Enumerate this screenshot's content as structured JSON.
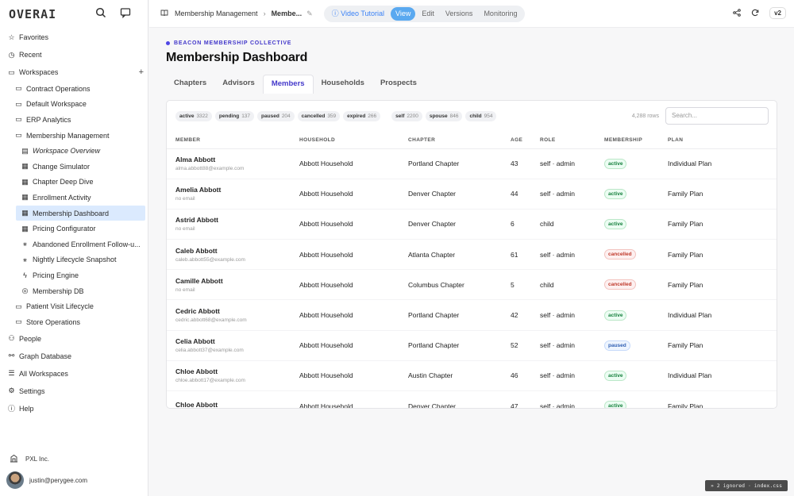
{
  "app": {
    "logo": "OVERAI"
  },
  "sidebar": {
    "top_items": [
      {
        "icon": "star-icon",
        "label": "Favorites"
      },
      {
        "icon": "clock-icon",
        "label": "Recent"
      },
      {
        "icon": "folder-icon",
        "label": "Workspaces"
      }
    ],
    "workspaces": [
      {
        "label": "Contract Operations",
        "level": 1
      },
      {
        "label": "Default Workspace",
        "level": 1
      },
      {
        "label": "ERP Analytics",
        "level": 1
      },
      {
        "label": "Membership Management",
        "level": 1
      },
      {
        "label": "Workspace Overview",
        "level": 2,
        "italic": true,
        "icon": "book-icon"
      },
      {
        "label": "Change Simulator",
        "level": 2,
        "icon": "table-icon"
      },
      {
        "label": "Chapter Deep Dive",
        "level": 2,
        "icon": "table-icon"
      },
      {
        "label": "Enrollment Activity",
        "level": 2,
        "icon": "table-icon"
      },
      {
        "label": "Membership Dashboard",
        "level": 2,
        "icon": "table-icon",
        "active": true
      },
      {
        "label": "Pricing Configurator",
        "level": 2,
        "icon": "table-icon"
      },
      {
        "label": "Abandoned Enrollment Follow-u...",
        "level": 2,
        "icon": "workflow-icon"
      },
      {
        "label": "Nightly Lifecycle Snapshot",
        "level": 2,
        "icon": "workflow-icon"
      },
      {
        "label": "Pricing Engine",
        "level": 2,
        "icon": "bolt-icon"
      },
      {
        "label": "Membership DB",
        "level": 2,
        "icon": "database-icon"
      },
      {
        "label": "Patient Visit Lifecycle",
        "level": 1
      },
      {
        "label": "Store Operations",
        "level": 1
      }
    ],
    "bottom_items": [
      {
        "icon": "people-icon",
        "label": "People"
      },
      {
        "icon": "graph-icon",
        "label": "Graph Database"
      },
      {
        "icon": "list-icon",
        "label": "All Workspaces"
      },
      {
        "icon": "gear-icon",
        "label": "Settings"
      },
      {
        "icon": "help-icon",
        "label": "Help"
      }
    ],
    "org": "PXL Inc.",
    "user": "justin@perygee.com"
  },
  "topbar": {
    "crumb1": "Membership Management",
    "crumb2": "Membe...",
    "video": "Video Tutorial",
    "view": "View",
    "edit": "Edit",
    "versions": "Versions",
    "monitoring": "Monitoring",
    "version_badge": "v2"
  },
  "page": {
    "org_label": "BEACON MEMBERSHIP COLLECTIVE",
    "title": "Membership Dashboard",
    "tabs": [
      "Chapters",
      "Advisors",
      "Members",
      "Households",
      "Prospects"
    ],
    "active_tab": "Members"
  },
  "filters": {
    "status": [
      {
        "label": "active",
        "count": "3322"
      },
      {
        "label": "pending",
        "count": "137"
      },
      {
        "label": "paused",
        "count": "204"
      },
      {
        "label": "cancelled",
        "count": "359"
      },
      {
        "label": "expired",
        "count": "266"
      }
    ],
    "role": [
      {
        "label": "self",
        "count": "2200"
      },
      {
        "label": "spouse",
        "count": "846"
      },
      {
        "label": "child",
        "count": "954"
      }
    ],
    "rows_count": "4,288 rows",
    "search_placeholder": "Search..."
  },
  "table": {
    "columns": [
      "MEMBER",
      "HOUSEHOLD",
      "CHAPTER",
      "AGE",
      "ROLE",
      "MEMBERSHIP",
      "PLAN"
    ],
    "rows": [
      {
        "name": "Alma Abbott",
        "email": "alma.abbott88@example.com",
        "household": "Abbott Household",
        "chapter": "Portland Chapter",
        "age": "43",
        "role": "self · admin",
        "status": "active",
        "plan": "Individual Plan"
      },
      {
        "name": "Amelia Abbott",
        "email": "no email",
        "household": "Abbott Household",
        "chapter": "Denver Chapter",
        "age": "44",
        "role": "self · admin",
        "status": "active",
        "plan": "Family Plan"
      },
      {
        "name": "Astrid Abbott",
        "email": "no email",
        "household": "Abbott Household",
        "chapter": "Denver Chapter",
        "age": "6",
        "role": "child",
        "status": "active",
        "plan": "Family Plan"
      },
      {
        "name": "Caleb Abbott",
        "email": "caleb.abbott55@example.com",
        "household": "Abbott Household",
        "chapter": "Atlanta Chapter",
        "age": "61",
        "role": "self · admin",
        "status": "cancelled",
        "plan": "Family Plan"
      },
      {
        "name": "Camille Abbott",
        "email": "no email",
        "household": "Abbott Household",
        "chapter": "Columbus Chapter",
        "age": "5",
        "role": "child",
        "status": "cancelled",
        "plan": "Family Plan"
      },
      {
        "name": "Cedric Abbott",
        "email": "cedric.abbott68@example.com",
        "household": "Abbott Household",
        "chapter": "Portland Chapter",
        "age": "42",
        "role": "self · admin",
        "status": "active",
        "plan": "Individual Plan"
      },
      {
        "name": "Celia Abbott",
        "email": "celia.abbott37@example.com",
        "household": "Abbott Household",
        "chapter": "Portland Chapter",
        "age": "52",
        "role": "self · admin",
        "status": "paused",
        "plan": "Family Plan"
      },
      {
        "name": "Chloe Abbott",
        "email": "chloe.abbott17@example.com",
        "household": "Abbott Household",
        "chapter": "Austin Chapter",
        "age": "46",
        "role": "self · admin",
        "status": "active",
        "plan": "Individual Plan"
      },
      {
        "name": "Chloe Abbott",
        "email": "",
        "household": "Abbott Household",
        "chapter": "Denver Chapter",
        "age": "47",
        "role": "self · admin",
        "status": "active",
        "plan": "Family Plan"
      }
    ]
  },
  "toast": "» 2 ignored · index.css"
}
